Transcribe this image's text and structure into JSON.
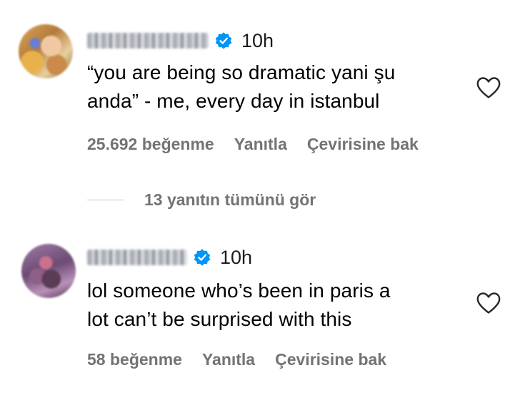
{
  "comments": [
    {
      "time": "10h",
      "text_lines": [
        "“you are being so dramatic yani şu",
        "anda” - me, every day in istanbul"
      ],
      "likes": "25.692 beğenme",
      "reply_label": "Yanıtla",
      "translate_label": "Çevirisine bak",
      "view_replies": "13 yanıtın tümünü gör"
    },
    {
      "time": "10h",
      "text_lines": [
        "lol someone who’s been in paris a",
        "lot can’t be surprised with this"
      ],
      "likes": "58 beğenme",
      "reply_label": "Yanıtla",
      "translate_label": "Çevirisine bak"
    }
  ],
  "colors": {
    "verified": "#0095f6",
    "meta_text": "#737373",
    "text": "#000000",
    "divider": "#c7c7c7"
  },
  "icons": {
    "verified": "verified-badge-icon",
    "like": "heart-outline-icon"
  }
}
